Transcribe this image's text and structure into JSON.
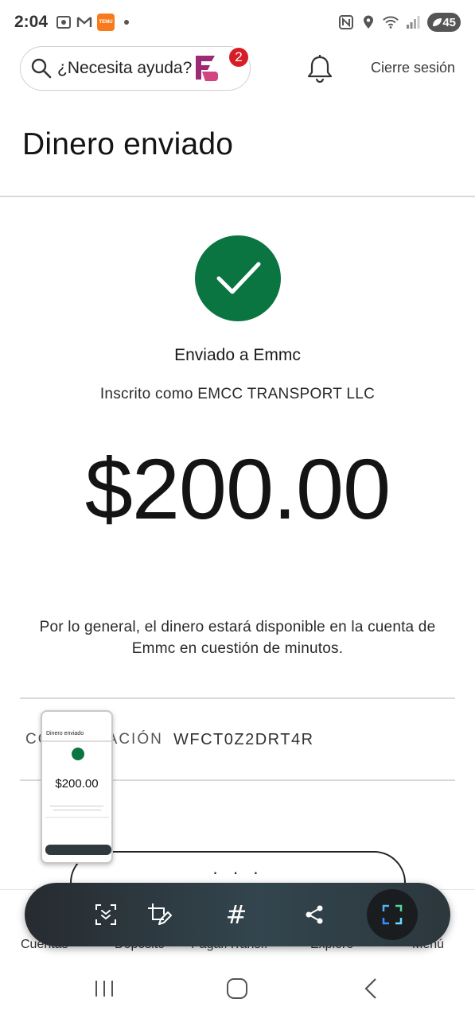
{
  "status_bar": {
    "time": "2:04",
    "battery": "45",
    "temu_badge_text": "TEMU"
  },
  "header": {
    "search_placeholder": "¿Necesita ayuda?",
    "notification_count": "2",
    "logout_label": "Cierre sesión"
  },
  "page": {
    "title": "Dinero enviado",
    "sent_to": "Enviado a Emmc",
    "enrolled_as": "Inscrito como EMCC TRANSPORT LLC",
    "amount": "$200.00",
    "availability_note": "Por lo general, el dinero estará disponible en la cuenta de Emmc en cuestión de minutos.",
    "confirmation_label": "CONFIRMACIÓN",
    "confirmation_value": "WFCT0Z2DRT4R",
    "more_button_label": "· · ·"
  },
  "bottom_nav": {
    "items": [
      "Cuentas",
      "Depósito",
      "Pagar/Transf.",
      "Explore",
      "Menú"
    ]
  },
  "screenshot_preview": {
    "title": "Dinero enviado",
    "amount": "$200.00"
  },
  "toolbar": {
    "icons": [
      "scroll-capture-icon",
      "crop-edit-icon",
      "tag-icon",
      "share-icon",
      "capture-icon"
    ]
  },
  "colors": {
    "success_green": "#0a7540",
    "badge_red": "#d71e28",
    "brand_purple": "#9c2a75"
  }
}
